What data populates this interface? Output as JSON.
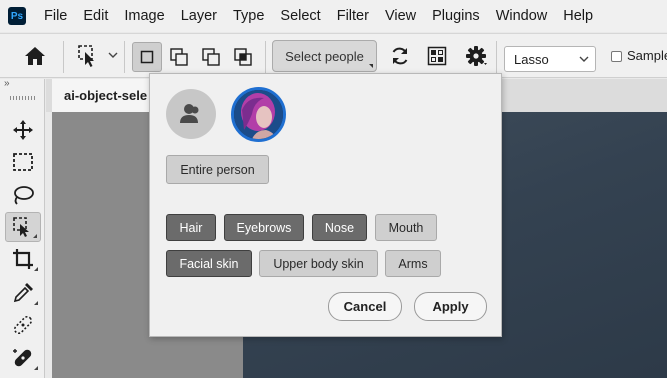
{
  "app": {
    "logo": "Ps"
  },
  "menu": [
    "File",
    "Edit",
    "Image",
    "Layer",
    "Type",
    "Select",
    "Filter",
    "View",
    "Plugins",
    "Window",
    "Help"
  ],
  "options": {
    "select_people_label": "Select people",
    "mode_dropdown_value": "Lasso",
    "sample_all_label": "Sample"
  },
  "document": {
    "tab_title": "ai-object-sele"
  },
  "popup": {
    "entire_person_label": "Entire person",
    "parts": [
      {
        "label": "Hair",
        "selected": true
      },
      {
        "label": "Eyebrows",
        "selected": true
      },
      {
        "label": "Nose",
        "selected": true
      },
      {
        "label": "Mouth",
        "selected": false
      },
      {
        "label": "Facial skin",
        "selected": true
      },
      {
        "label": "Upper body skin",
        "selected": false
      },
      {
        "label": "Arms",
        "selected": false
      }
    ],
    "cancel_label": "Cancel",
    "apply_label": "Apply"
  },
  "colors": {
    "accent": "#1f6fd1",
    "selected_part": "#6b6b6b",
    "unselected_part": "#cfcfcf"
  }
}
